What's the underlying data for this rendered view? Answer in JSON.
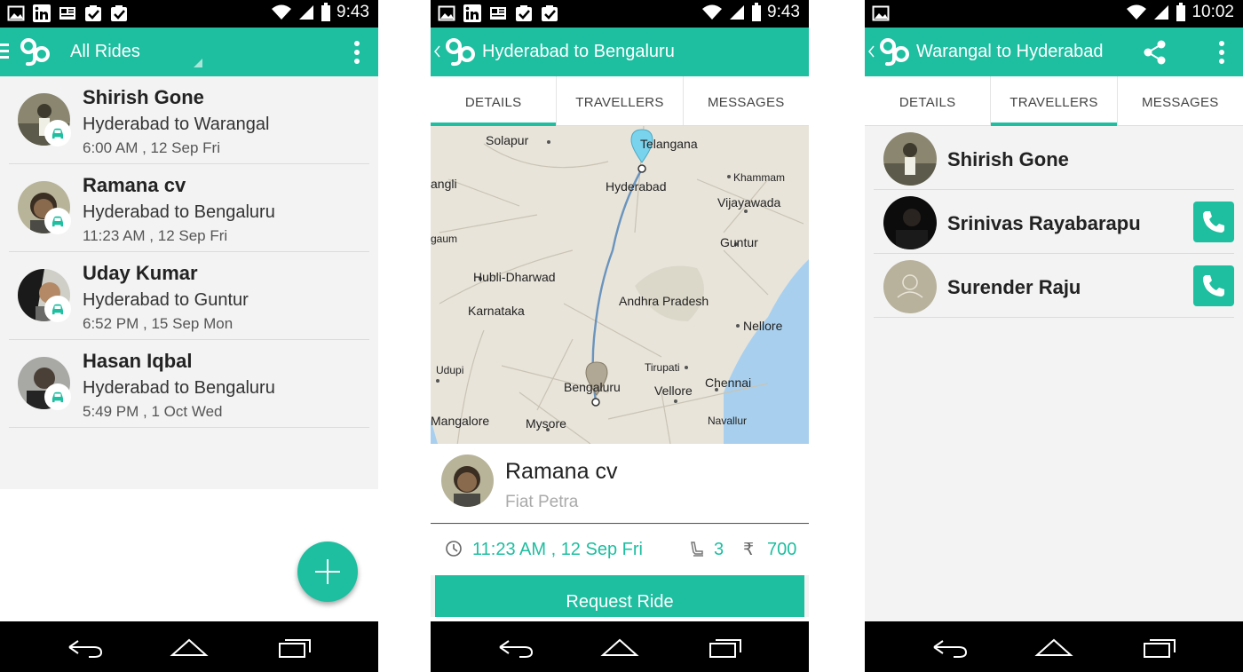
{
  "colors": {
    "accent": "#1ebea0",
    "text": "#222222",
    "subtle": "#aaaaaa"
  },
  "screen1": {
    "status_time": "9:43",
    "title": "All Rides",
    "rides": [
      {
        "name": "Shirish Gone",
        "route": "Hyderabad to Warangal",
        "time": "6:00 AM , 12 Sep Fri"
      },
      {
        "name": "Ramana cv",
        "route": "Hyderabad to Bengaluru",
        "time": "11:23 AM , 12 Sep Fri"
      },
      {
        "name": "Uday Kumar",
        "route": "Hyderabad to Guntur",
        "time": "6:52 PM , 15 Sep Mon"
      },
      {
        "name": "Hasan Iqbal",
        "route": "Hyderabad to Bengaluru",
        "time": "5:49 PM , 1 Oct Wed"
      }
    ],
    "fab_icon": "plus-icon"
  },
  "screen2": {
    "status_time": "9:43",
    "title": "Hyderabad to Bengaluru",
    "tabs": [
      {
        "label": "DETAILS"
      },
      {
        "label": "TRAVELLERS"
      },
      {
        "label": "MESSAGES"
      }
    ],
    "map_labels": {
      "solapur": "Solapur",
      "telangana": "Telangana",
      "hyderabad": "Hyderabad",
      "khammam": "Khammam",
      "angli": "angli",
      "vijayawada": "Vijayawada",
      "guntur": "Guntur",
      "gaum": "gaum",
      "hubli": "Hubli-Dharwad",
      "andhra": "Andhra Pradesh",
      "karnataka": "Karnataka",
      "nellore": "Nellore",
      "udupi": "Udupi",
      "tirupati": "Tirupati",
      "bengaluru": "Bengaluru",
      "vellore": "Vellore",
      "chennai": "Chennai",
      "mangalore": "Mangalore",
      "mysore": "Mysore",
      "navallur": "Navallur"
    },
    "driver": {
      "name": "Ramana cv",
      "car": "Fiat Petra"
    },
    "ride_time": "11:23 AM , 12 Sep Fri",
    "seats": "3",
    "currency": "₹",
    "price": "700",
    "request_label": "Request Ride"
  },
  "screen3": {
    "status_time": "10:02",
    "title": "Warangal to Hyderabad",
    "tabs": [
      {
        "label": "DETAILS"
      },
      {
        "label": "TRAVELLERS"
      },
      {
        "label": "MESSAGES"
      }
    ],
    "travellers": [
      {
        "name": "Shirish Gone"
      },
      {
        "name": "Srinivas Rayabarapu"
      },
      {
        "name": "Surender Raju"
      }
    ]
  }
}
